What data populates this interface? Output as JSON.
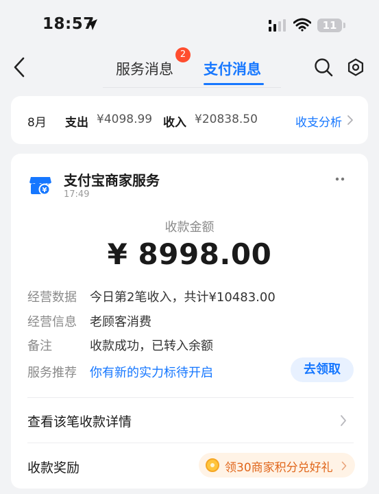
{
  "status_bar": {
    "time": "18:57",
    "battery": "11"
  },
  "nav": {
    "tabs": [
      {
        "label": "服务消息",
        "badge": "2",
        "active": false
      },
      {
        "label": "支付消息",
        "active": true
      }
    ]
  },
  "summary": {
    "month": "8月",
    "expense_label": "支出",
    "expense_value": "¥4098.99",
    "income_label": "收入",
    "income_value": "¥20838.50",
    "analysis_link": "收支分析"
  },
  "message": {
    "merchant": "支付宝商家服务",
    "time": "17:49",
    "amount_label": "收款金额",
    "amount": "¥ 8998.00",
    "rows": [
      {
        "label": "经营数据",
        "value": "今日第2笔收入，共计¥10483.00"
      },
      {
        "label": "经营信息",
        "value": "老顾客消费"
      },
      {
        "label": "备注",
        "value": "收款成功，已转入余额"
      },
      {
        "label": "服务推荐",
        "value": "你有新的实力标待开启",
        "button": "去领取"
      }
    ],
    "detail_link": "查看该笔收款详情",
    "reward_label": "收款奖励",
    "reward_offer": "领30商家积分兑好礼"
  },
  "colors": {
    "accent": "#1677ff",
    "badge": "#ff4d2e",
    "reward": "#e0661b"
  },
  "icons": [
    "location-arrow-icon",
    "signal-icon",
    "wifi-icon",
    "battery-icon",
    "back-icon",
    "search-icon",
    "gear-icon",
    "chevron-right-icon",
    "merchant-shop-icon",
    "more-icon",
    "coin-icon"
  ]
}
